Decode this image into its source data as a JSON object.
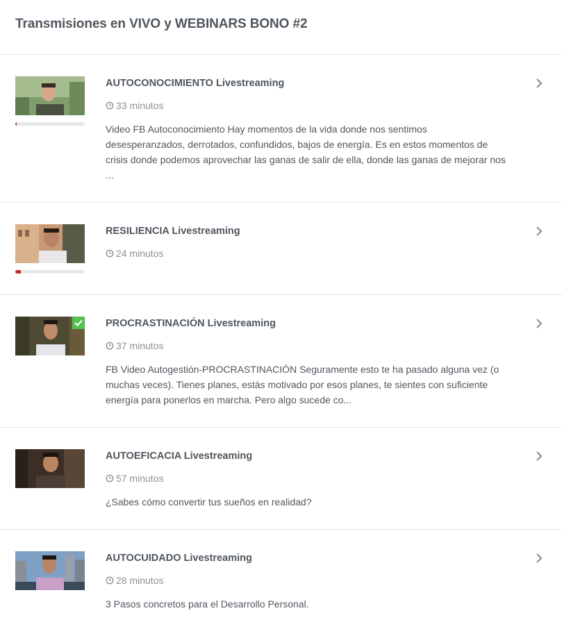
{
  "section": {
    "title": "Transmisiones en VIVO y WEBINARS BONO #2"
  },
  "lessons": [
    {
      "title": "AUTOCONOCIMIENTO Livestreaming",
      "duration": "33 minutos",
      "description": "Video FB Autoconocimiento Hay momentos de la vida donde nos sentimos desesperanzados, derrotados, confundidos, bajos de energía. Es en estos momentos de crisis donde podemos aprovechar las ganas de salir de ella, donde las ganas de mejorar nos ...",
      "progress": 0.02,
      "completed": false
    },
    {
      "title": "RESILIENCIA Livestreaming",
      "duration": "24 minutos",
      "description": "",
      "progress": 0.08,
      "completed": false
    },
    {
      "title": "PROCRASTINACIÓN Livestreaming",
      "duration": "37 minutos",
      "description": "FB Video Autogestión-PROCRASTINACIÓN Seguramente esto te ha pasado alguna vez (o muchas veces). Tienes planes, estás motivado por esos planes, te sientes con suficiente energía para ponerlos en marcha. Pero algo sucede co...",
      "progress": null,
      "completed": true
    },
    {
      "title": "AUTOEFICACIA Livestreaming",
      "duration": "57 minutos",
      "description": "¿Sabes cómo convertir tus sueños en realidad?",
      "progress": null,
      "completed": false
    },
    {
      "title": "AUTOCUIDADO Livestreaming",
      "duration": "28 minutos",
      "description": "3 Pasos concretos para el Desarrollo Personal.",
      "progress": null,
      "completed": false
    }
  ],
  "colors": {
    "progress": "#c8262b",
    "completed": "#4fc24f",
    "divider": "#e2e4e6"
  },
  "icons": {
    "duration": "clock-icon",
    "open": "chevron-right-icon",
    "completed": "checkmark-icon"
  }
}
